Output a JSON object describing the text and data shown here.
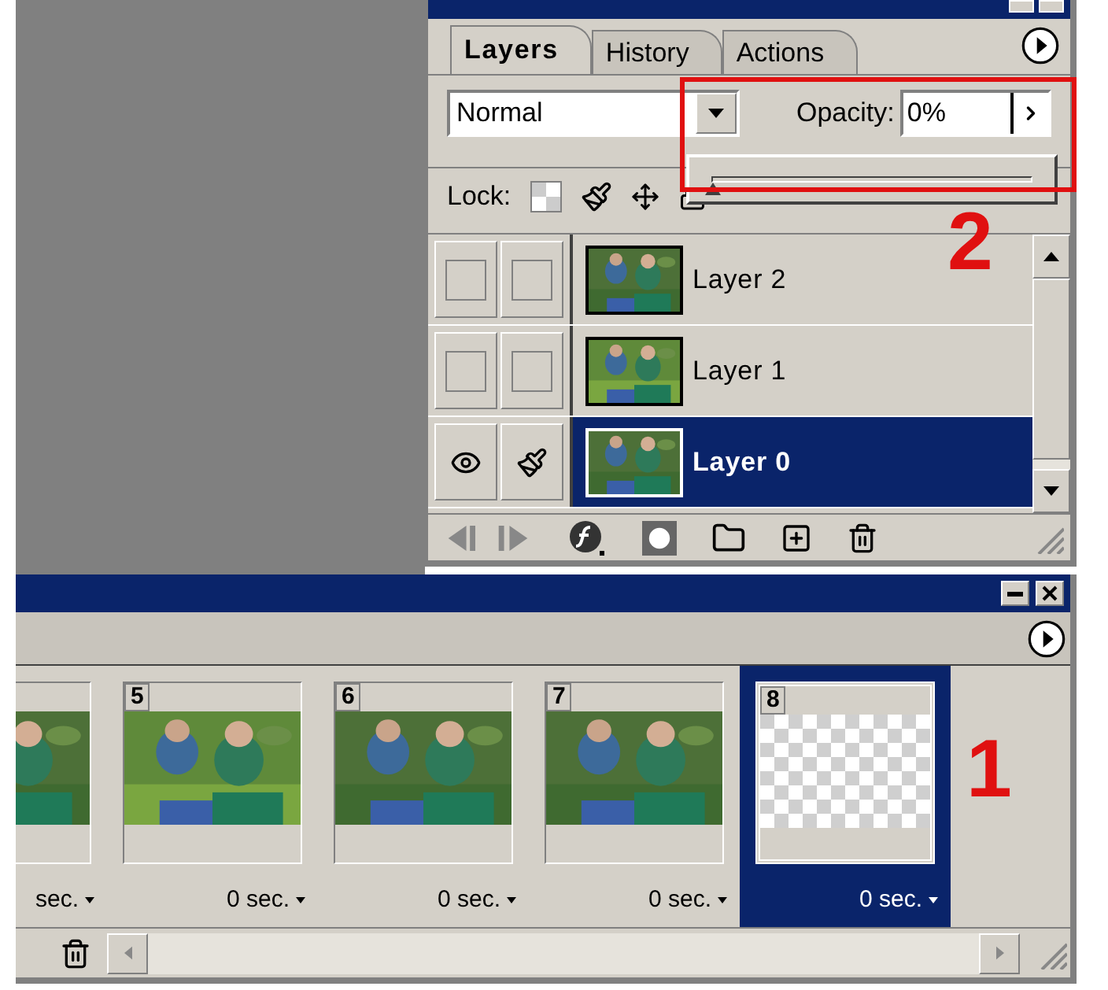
{
  "layers_palette": {
    "tabs": [
      {
        "label": "Layers",
        "selected": true
      },
      {
        "label": "History",
        "selected": false
      },
      {
        "label": "Actions",
        "selected": false
      }
    ],
    "blend_mode": "Normal",
    "opacity_label": "Opacity:",
    "opacity": "0%",
    "opacity_slider": {
      "level": 0
    },
    "lock_label": "Lock:",
    "layers": [
      {
        "name": "Layer 2",
        "visible": false,
        "brush": false,
        "selected": false
      },
      {
        "name": "Layer 1",
        "visible": false,
        "brush": false,
        "selected": false
      },
      {
        "name": "Layer 0",
        "visible": true,
        "brush": true,
        "selected": true
      }
    ]
  },
  "animation_palette": {
    "frames": [
      {
        "delay": "sec.",
        "selected": false
      },
      {
        "number": "5",
        "delay": "0 sec.",
        "selected": false
      },
      {
        "number": "6",
        "delay": "0 sec.",
        "selected": false
      },
      {
        "number": "7",
        "delay": "0 sec.",
        "selected": false
      },
      {
        "number": "8",
        "delay": "0 sec.",
        "kind": "empty",
        "selected": true
      }
    ]
  },
  "annotations": [
    "2",
    "1"
  ]
}
